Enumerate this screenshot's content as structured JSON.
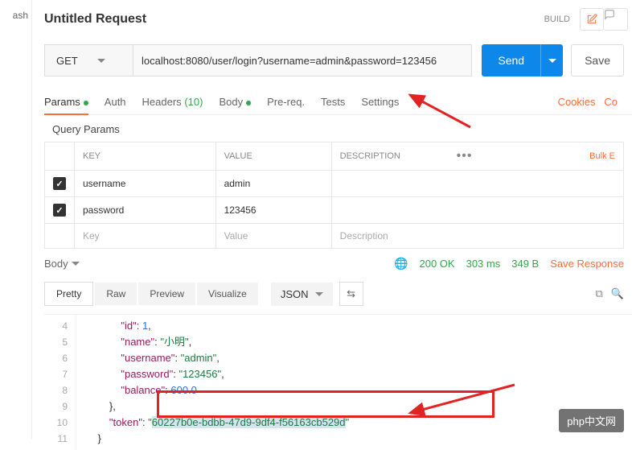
{
  "left_tab": "ash",
  "title": "Untitled Request",
  "build_label": "BUILD",
  "method": "GET",
  "url": "localhost:8080/user/login?username=admin&password=123456",
  "send_label": "Send",
  "save_label": "Save",
  "tabs": {
    "params": "Params",
    "auth": "Auth",
    "headers": "Headers",
    "headers_count": "(10)",
    "body": "Body",
    "prereq": "Pre-req.",
    "tests": "Tests",
    "settings": "Settings"
  },
  "cookies": "Cookies",
  "code_link": "Co",
  "query_title": "Query Params",
  "headers_row": {
    "key": "KEY",
    "value": "VALUE",
    "desc": "DESCRIPTION",
    "bulk": "Bulk E"
  },
  "params": [
    {
      "key": "username",
      "value": "admin"
    },
    {
      "key": "password",
      "value": "123456"
    }
  ],
  "placeholders": {
    "key": "Key",
    "value": "Value",
    "desc": "Description"
  },
  "response": {
    "body": "Body",
    "status": "200 OK",
    "time": "303 ms",
    "size": "349 B",
    "save": "Save Response"
  },
  "views": {
    "pretty": "Pretty",
    "raw": "Raw",
    "preview": "Preview",
    "visualize": "Visualize",
    "format": "JSON"
  },
  "code_lines": [
    {
      "n": 4,
      "indent": 3,
      "key": "id",
      "value": "1",
      "type": "number",
      "comma": true
    },
    {
      "n": 5,
      "indent": 3,
      "key": "name",
      "value": "小明",
      "type": "string",
      "comma": true
    },
    {
      "n": 6,
      "indent": 3,
      "key": "username",
      "value": "admin",
      "type": "string",
      "comma": true
    },
    {
      "n": 7,
      "indent": 3,
      "key": "password",
      "value": "123456",
      "type": "string",
      "comma": true
    },
    {
      "n": 8,
      "indent": 3,
      "key": "balance",
      "value": "600.0",
      "type": "number",
      "comma": false
    },
    {
      "n": 9,
      "indent": 2,
      "raw": "},"
    },
    {
      "n": 10,
      "indent": 2,
      "key": "token",
      "value": "60227b0e-bdbb-47d9-9df4-f56163cb529d",
      "type": "string-hl",
      "comma": false
    },
    {
      "n": 11,
      "indent": 1,
      "raw": "}"
    }
  ],
  "watermark": "php中文网"
}
